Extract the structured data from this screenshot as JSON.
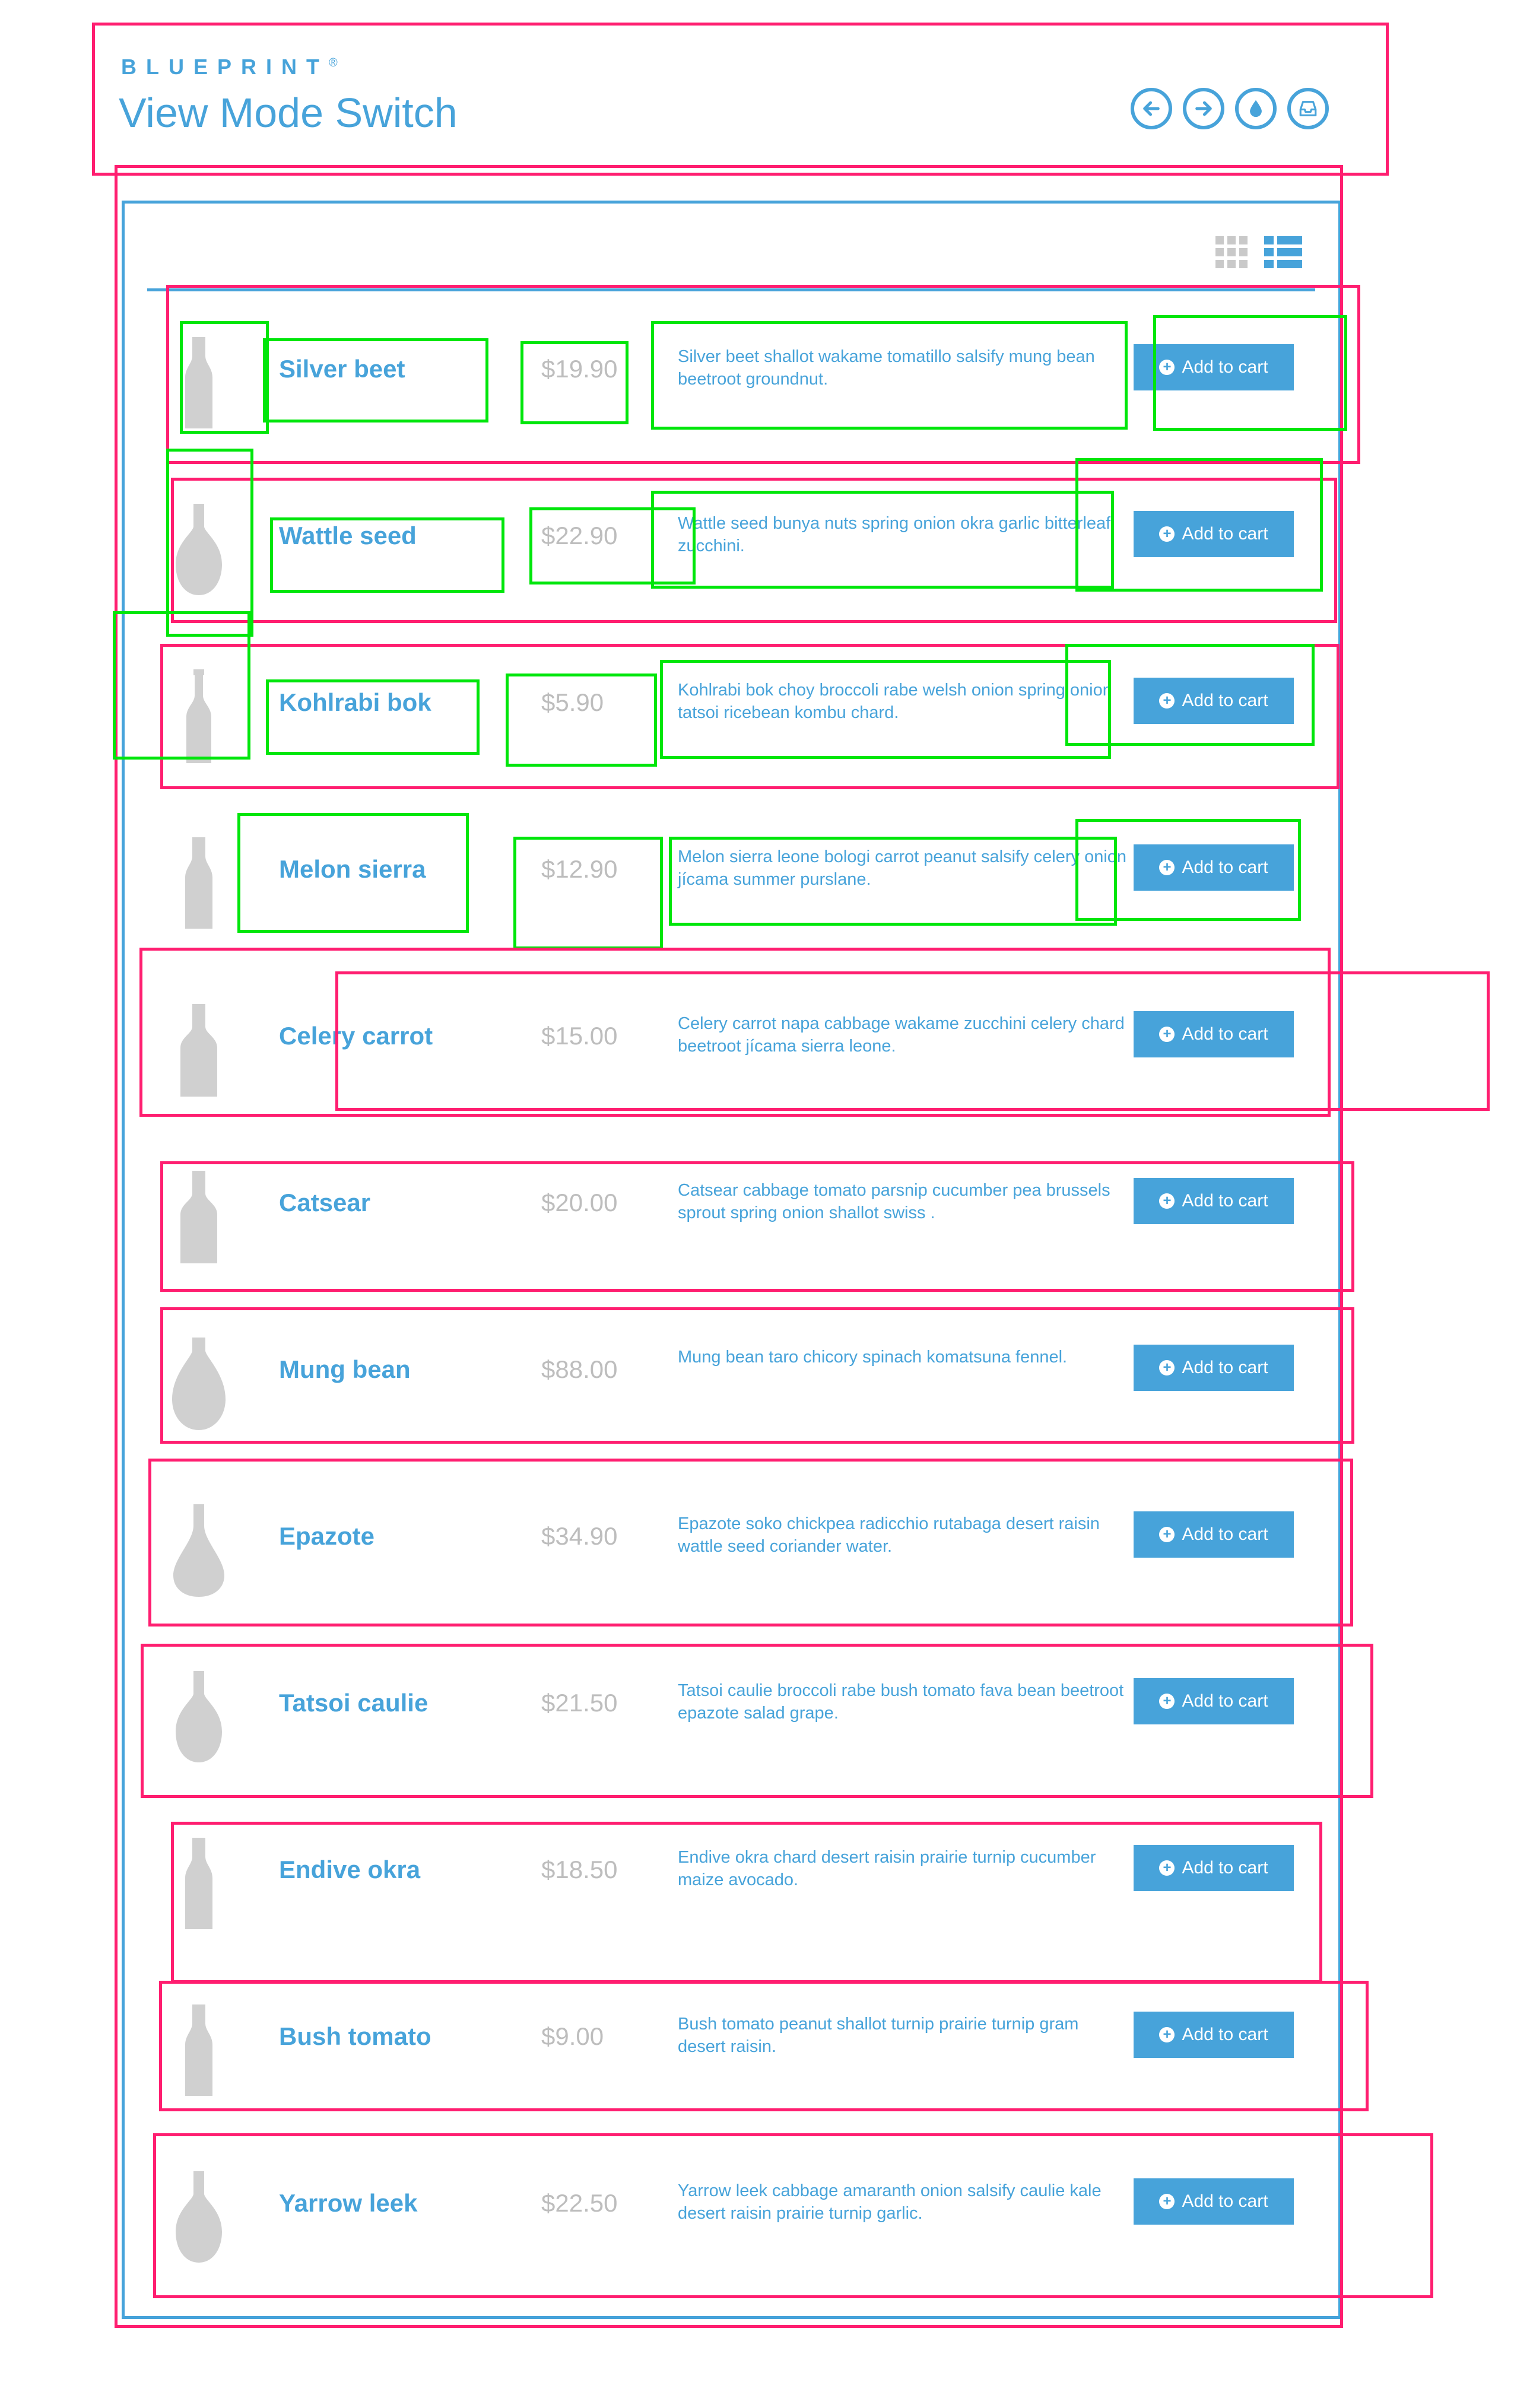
{
  "header": {
    "brand": "BLUEPRINT",
    "brand_mark": "®",
    "title": "View Mode Switch",
    "nav_icons": [
      "arrow-left-icon",
      "arrow-right-icon",
      "drop-icon",
      "inbox-icon"
    ]
  },
  "view_modes": {
    "grid_icon": "grid-view-icon",
    "list_icon": "list-view-icon",
    "active": "list"
  },
  "products": [
    {
      "name": "Silver beet",
      "price": "$19.90",
      "description": "Silver beet shallot wakame tomatillo salsify mung bean beetroot groundnut.",
      "button": "Add to cart",
      "bottle": "slim"
    },
    {
      "name": "Wattle seed",
      "price": "$22.90",
      "description": "Wattle seed bunya nuts spring onion okra garlic bitterleaf zucchini.",
      "button": "Add to cart",
      "bottle": "round"
    },
    {
      "name": "Kohlrabi bok",
      "price": "$5.90",
      "description": "Kohlrabi bok choy broccoli rabe welsh onion spring onion tatsoi ricebean kombu chard.",
      "button": "Add to cart",
      "bottle": "swing"
    },
    {
      "name": "Melon sierra",
      "price": "$12.90",
      "description": "Melon sierra leone bologi carrot peanut salsify celery onion jícama summer purslane.",
      "button": "Add to cart",
      "bottle": "slim"
    },
    {
      "name": "Celery carrot",
      "price": "$15.00",
      "description": "Celery carrot napa cabbage wakame zucchini celery chard beetroot jícama sierra leone.",
      "button": "Add to cart",
      "bottle": "wide"
    },
    {
      "name": "Catsear",
      "price": "$20.00",
      "description": "Catsear cabbage tomato parsnip cucumber pea brussels sprout spring onion shallot swiss .",
      "button": "Add to cart",
      "bottle": "wide"
    },
    {
      "name": "Mung bean",
      "price": "$88.00",
      "description": "Mung bean taro chicory spinach komatsuna fennel.",
      "button": "Add to cart",
      "bottle": "flask"
    },
    {
      "name": "Epazote",
      "price": "$34.90",
      "description": "Epazote soko chickpea radicchio rutabaga desert raisin wattle seed coriander water.",
      "button": "Add to cart",
      "bottle": "teardrop"
    },
    {
      "name": "Tatsoi caulie",
      "price": "$21.50",
      "description": "Tatsoi caulie broccoli rabe bush tomato fava bean beetroot epazote salad grape.",
      "button": "Add to cart",
      "bottle": "round"
    },
    {
      "name": "Endive okra",
      "price": "$18.50",
      "description": "Endive okra chard desert raisin prairie turnip cucumber maize avocado.",
      "button": "Add to cart",
      "bottle": "slim"
    },
    {
      "name": "Bush tomato",
      "price": "$9.00",
      "description": "Bush tomato peanut shallot turnip prairie turnip gram desert raisin.",
      "button": "Add to cart",
      "bottle": "slim"
    },
    {
      "name": "Yarrow leek",
      "price": "$22.50",
      "description": "Yarrow leek cabbage amaranth onion salsify caulie kale desert raisin prairie turnip garlic.",
      "button": "Add to cart",
      "bottle": "round"
    }
  ],
  "colors": {
    "accent": "#47a3da",
    "muted_price": "#bdbdbd",
    "bottle": "#d0d0d0",
    "annotation_pink": "#ff1e70",
    "annotation_green": "#00e60a"
  }
}
